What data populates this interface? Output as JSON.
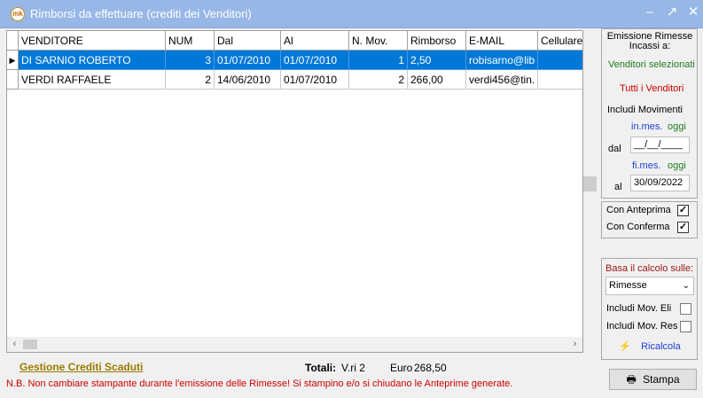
{
  "window": {
    "title": "Rimborsi da effettuare (crediti dei  Venditori)",
    "app_icon": "mk",
    "controls": {
      "minimize": "–",
      "maximize": "↗",
      "close": "✕"
    }
  },
  "grid": {
    "columns": [
      "VENDITORE",
      "NUM",
      "Dal",
      "Al",
      "N. Mov.",
      "Rimborso",
      "E-MAIL",
      "Cellulare"
    ],
    "rows": [
      {
        "selected": true,
        "cells": [
          "DI SARNIO ROBERTO",
          "3",
          "01/07/2010",
          "01/07/2010",
          "1",
          "2,50",
          "robisarno@lib"
        ]
      },
      {
        "selected": false,
        "cells": [
          "VERDI RAFFAELE",
          "2",
          "14/06/2010",
          "01/07/2010",
          "2",
          "266,00",
          "verdi456@tin."
        ]
      }
    ],
    "row_indicator": "▶"
  },
  "side": {
    "header": "Emissione Rimesse Incassi a:",
    "venditori_selezionati": "Venditori selezionati",
    "tutti_venditori": "Tutti i Venditori",
    "includi_movimenti": "Includi Movimenti",
    "in_mes": "in.mes.",
    "oggi1": "oggi",
    "dal_label": "dal",
    "dal_value": "__/__/____",
    "fi_mes": "fi.mes.",
    "oggi2": "oggi",
    "al_label": "al",
    "al_value": "30/09/2022",
    "con_anteprima": "Con Anteprima",
    "con_conferma": "Con Conferma",
    "basa_calcolo": "Basa il calcolo sulle:",
    "calcolo_value": "Rimesse",
    "includi_mov_eli": "Includi Mov. Eli",
    "includi_mov_res": "Includi Mov. Res",
    "ricalcola": "Ricalcola",
    "stampa": "Stampa"
  },
  "footer": {
    "link": "Gestione Crediti Scaduti",
    "totali_label": "Totali:",
    "totali_count": "V.ri 2",
    "euro_label": "Euro",
    "euro_value": "268,50",
    "nb": "N.B. Non cambiare stampante durante l'emissione delle Rimesse! Si stampino e/o si chiudano le Anteprime generate."
  },
  "colors": {
    "titlebar": "#97b7e6",
    "selection": "#0078d7"
  }
}
